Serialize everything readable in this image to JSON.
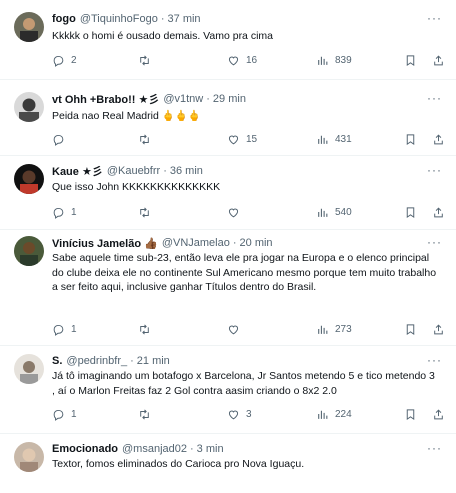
{
  "tweets": [
    {
      "name": "fogo",
      "handle": "@TiquinhoFogo",
      "time": "37 min",
      "text": "Kkkkk o homi é ousado demais. Vamo pra cima",
      "replies": "2",
      "retweets": "",
      "likes": "16",
      "views": "839"
    },
    {
      "name": "vt Ohh +Brabo!! ★彡",
      "handle": "@v1tnw",
      "time": "29 min",
      "text": "Peida nao Real Madrid 🖕🖕🖕",
      "replies": "",
      "retweets": "",
      "likes": "15",
      "views": "431"
    },
    {
      "name": "Kaue ★彡",
      "handle": "@Kauebfrr",
      "time": "36 min",
      "text": "Que isso John KKKKKKKKKKKKKK",
      "replies": "1",
      "retweets": "",
      "likes": "",
      "views": "540"
    },
    {
      "name": "Vinícius Jamelão 👍🏾",
      "handle": "@VNJamelao",
      "time": "20 min",
      "text": "Sabe aquele time sub-23, então leva ele pra jogar na Europa e o elenco principal do clube deixa ele no continente Sul Americano mesmo porque tem muito trabalho a ser feito aqui, inclusive ganhar Títulos dentro do Brasil.",
      "replies": "1",
      "retweets": "",
      "likes": "",
      "views": "273"
    },
    {
      "name": "S.",
      "handle": "@pedrinbfr_",
      "time": "21 min",
      "text": "Já tô imaginando um botafogo x Barcelona, Jr Santos metendo 5 e tico metendo 3 , aí o Marlon Freitas faz 2 Gol contra aasim criando o 8x2 2.0",
      "replies": "1",
      "retweets": "",
      "likes": "3",
      "views": "224"
    },
    {
      "name": "Emocionado",
      "handle": "@msanjad02",
      "time": "3 min",
      "text": "Textor, fomos eliminados do Carioca pro Nova Iguaçu.",
      "replies": "",
      "retweets": "",
      "likes": "",
      "views": ""
    }
  ],
  "more_label": "···",
  "dot": "·",
  "colors": {
    "text": "#0f1419",
    "secondary": "#536471",
    "border": "#eff3f4"
  }
}
